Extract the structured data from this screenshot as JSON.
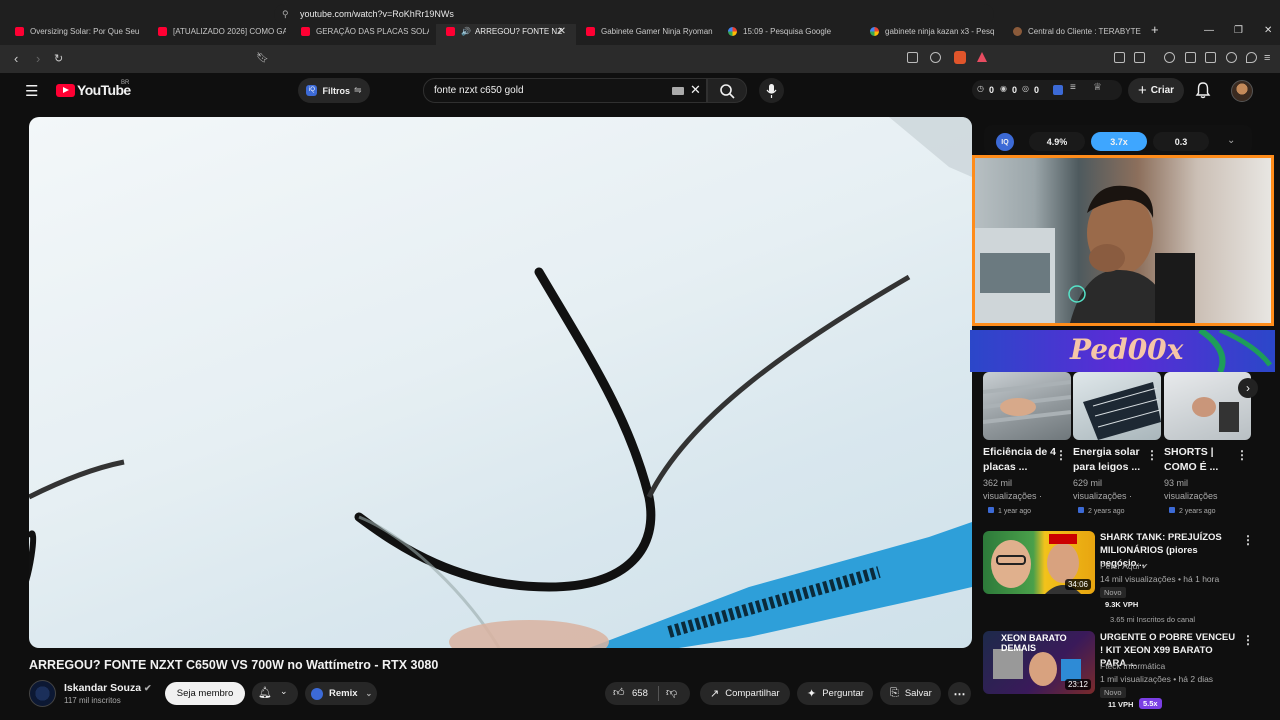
{
  "tabs": [
    {
      "label": "Oversizing Solar: Por Que Seu",
      "icon": "youtube-favicon"
    },
    {
      "label": "[ATUALIZADO 2026] COMO GA",
      "icon": "youtube-favicon"
    },
    {
      "label": "GERAÇÃO DAS PLACAS SOLAR",
      "icon": "youtube-favicon"
    },
    {
      "label": "ARREGOU? FONTE NZ",
      "icon": "youtube-favicon",
      "active": true
    },
    {
      "label": "Gabinete Gamer Ninja Ryoman",
      "icon": "youtube-favicon"
    },
    {
      "label": "15:09 - Pesquisa Google",
      "icon": "google-favicon"
    },
    {
      "label": "gabinete ninja kazan x3 - Pesq",
      "icon": "google-favicon"
    },
    {
      "label": "Central do Cliente : TERABYTE",
      "icon": "terabyte-favicon"
    }
  ],
  "url": "youtube.com/watch?v=RoKhRr19NWs",
  "youtube": {
    "logo_text": "YouTube",
    "region": "BR",
    "filters_label": "Filtros",
    "search_value": "fonte nzxt c650 gold",
    "counters": [
      "0",
      "0",
      "0"
    ],
    "create_label": "Criar"
  },
  "stats": [
    "4.9%",
    "3.7x",
    "0.3"
  ],
  "banner_text": "Ped00x",
  "shorts": [
    {
      "title": "Eficiência de 4 placas ...",
      "views": "362 mil visualizações ·",
      "ago": "1 year ago"
    },
    {
      "title": "Energia solar para leigos ...",
      "views": "629 mil visualizações ·",
      "ago": "2 years ago"
    },
    {
      "title": "SHORTS | COMO É ...",
      "views": "93 mil visualizações",
      "ago": "2 years ago"
    }
  ],
  "recommended": [
    {
      "title": "SHARK TANK: PREJUÍZOS MILIONÁRIOS (piores negócio...",
      "channel": "Peter Aqui",
      "meta": "14 mil visualizações • há 1 hora",
      "badge": "Novo",
      "vph": "9.3K VPH",
      "subs": "3.65 mi Inscritos do canal",
      "duration": "34:06"
    },
    {
      "title": "URGENTE O POBRE VENCEU ! KIT XEON X99 BARATO PARA ...",
      "channel": "Fteck Informática",
      "meta": "1 mil visualizações • há 2 dias",
      "badge": "Novo",
      "vph": "11 VPH",
      "mult": "5.5x",
      "duration": "23:12",
      "thumb_text": "XEON BARATO DEMAIS"
    }
  ],
  "video": {
    "title": "ARREGOU? FONTE NZXT C650W VS 700W no Wattímetro - RTX 3080",
    "channel": "Iskandar Souza",
    "subscribers": "117 mil inscritos",
    "member_label": "Seja membro",
    "remix_label": "Remix",
    "likes": "658",
    "share_label": "Compartilhar",
    "ask_label": "Perguntar",
    "save_label": "Salvar"
  },
  "colors": {
    "accent_blue": "#3ea6ff",
    "youtube_red": "#ff0033",
    "webcam_border": "#ff8c1a",
    "banner_purple": "#5b2bd6"
  }
}
